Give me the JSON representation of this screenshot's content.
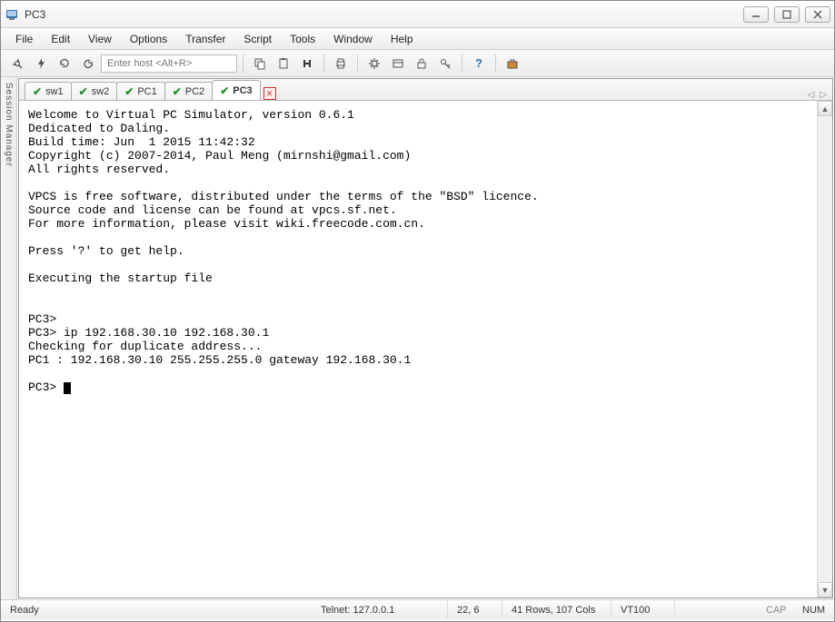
{
  "window": {
    "title": "PC3"
  },
  "menus": [
    "File",
    "Edit",
    "View",
    "Options",
    "Transfer",
    "Script",
    "Tools",
    "Window",
    "Help"
  ],
  "host_placeholder": "Enter host <Alt+R>",
  "side_panel": "Session Manager",
  "tabs": [
    {
      "label": "sw1",
      "active": false
    },
    {
      "label": "sw2",
      "active": false
    },
    {
      "label": "PC1",
      "active": false
    },
    {
      "label": "PC2",
      "active": false
    },
    {
      "label": "PC3",
      "active": true
    }
  ],
  "terminal_lines": [
    "Welcome to Virtual PC Simulator, version 0.6.1",
    "Dedicated to Daling.",
    "Build time: Jun  1 2015 11:42:32",
    "Copyright (c) 2007-2014, Paul Meng (mirnshi@gmail.com)",
    "All rights reserved.",
    "",
    "VPCS is free software, distributed under the terms of the \"BSD\" licence.",
    "Source code and license can be found at vpcs.sf.net.",
    "For more information, please visit wiki.freecode.com.cn.",
    "",
    "Press '?' to get help.",
    "",
    "Executing the startup file",
    "",
    "",
    "PC3>",
    "PC3> ip 192.168.30.10 192.168.30.1",
    "Checking for duplicate address...",
    "PC1 : 192.168.30.10 255.255.255.0 gateway 192.168.30.1",
    "",
    "PC3> "
  ],
  "status": {
    "ready": "Ready",
    "conn": "Telnet: 127.0.0.1",
    "pos": "22,   6",
    "size": "41 Rows, 107 Cols",
    "term": "VT100",
    "cap": "CAP",
    "num": "NUM"
  }
}
